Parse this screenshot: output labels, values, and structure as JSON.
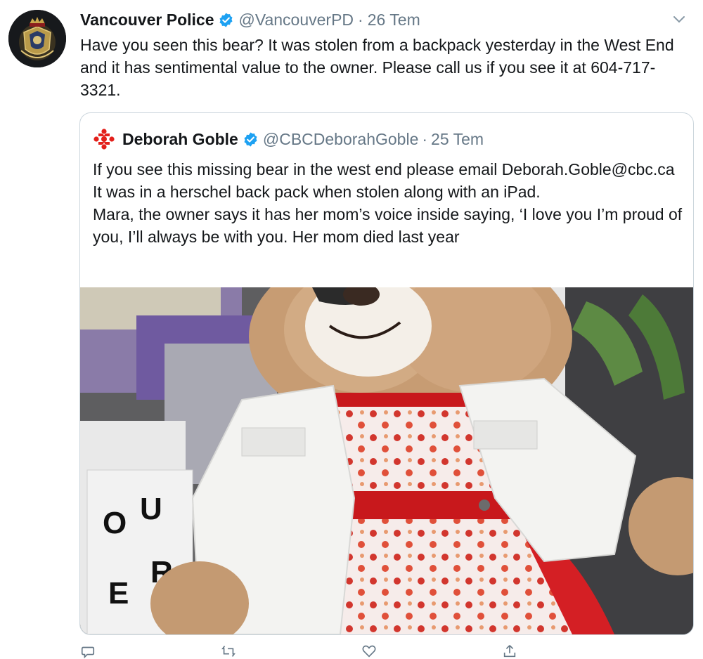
{
  "tweet": {
    "author_name": "Vancouver Police",
    "handle": "@VancouverPD",
    "separator": "·",
    "date": "26 Tem",
    "text": "Have you seen this bear? It was stolen from a backpack yesterday in the West End and it has sentimental value to the owner. Please call us if you see it at 604-717-3321."
  },
  "quoted": {
    "author_name": "Deborah Goble",
    "handle": "@CBCDeborahGoble",
    "separator": "·",
    "date": "25 Tem",
    "lines": [
      "If you see this missing bear in the west end please email Deborah.Goble@cbc.ca",
      "It was in a herschel back pack when stolen along with an iPad.",
      "Mara, the owner says it has her mom’s voice inside saying, ‘I love you I’m proud of you, I’ll always be with you. Her mom died last year"
    ],
    "lightbox_letters": [
      "O",
      "U",
      "E",
      "R"
    ]
  },
  "icons": {
    "verified": "verified-badge-icon",
    "caret": "chevron-down-icon",
    "reply": "reply-icon",
    "retweet": "retweet-icon",
    "like": "heart-icon",
    "share": "share-icon"
  },
  "colors": {
    "verified": "#1da1f2",
    "cbc_red": "#e3201b",
    "secondary_text": "#657786"
  }
}
